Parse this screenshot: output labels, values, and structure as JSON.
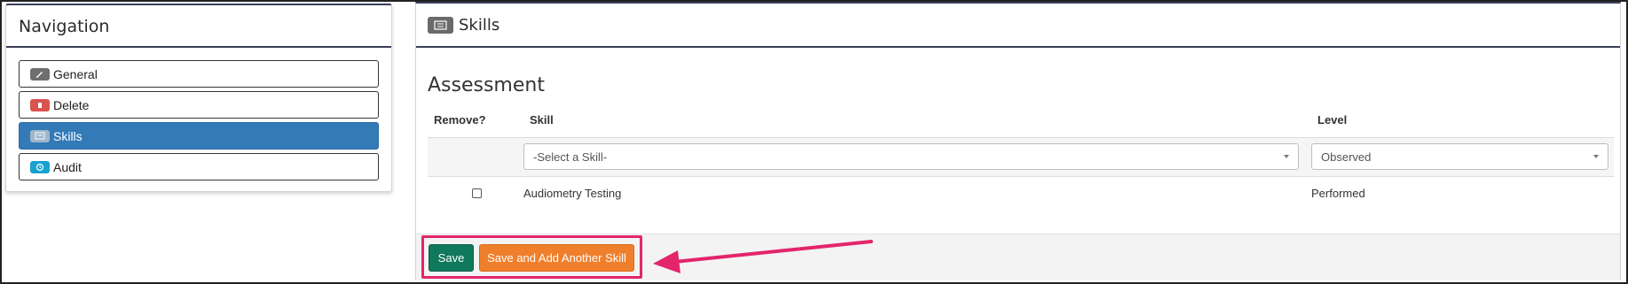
{
  "nav": {
    "title": "Navigation",
    "items": [
      {
        "label": "General",
        "icon": "pencil-icon"
      },
      {
        "label": "Delete",
        "icon": "trash-icon"
      },
      {
        "label": "Skills",
        "icon": "card-icon",
        "active": true
      },
      {
        "label": "Audit",
        "icon": "history-icon"
      }
    ]
  },
  "main": {
    "title": "Skills",
    "section_title": "Assessment",
    "table": {
      "columns": [
        "Remove?",
        "Skill",
        "Level"
      ],
      "skill_select": "-Select a Skill-",
      "level_select": "Observed",
      "rows": [
        {
          "skill": "Audiometry Testing",
          "level": "Performed",
          "remove": false
        }
      ]
    },
    "buttons": {
      "save": "Save",
      "save_add": "Save and Add Another Skill"
    }
  },
  "colors": {
    "active_nav": "#337ab7",
    "save_button": "#10785b",
    "save_add_button": "#f07f2b",
    "highlight": "#e3256b"
  }
}
